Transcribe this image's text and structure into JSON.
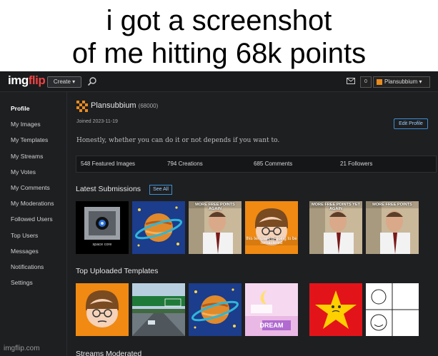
{
  "caption": {
    "line1": "i got a screenshot",
    "line2": "of me hitting 68k points"
  },
  "topbar": {
    "logo_main": "img",
    "logo_accent": "flip",
    "create_label": "Create ▾",
    "notif_count": "0",
    "user_label": "Plansubbium ▾"
  },
  "sidebar": {
    "items": [
      {
        "label": "Profile"
      },
      {
        "label": "My Images"
      },
      {
        "label": "My Templates"
      },
      {
        "label": "My Streams"
      },
      {
        "label": "My Votes"
      },
      {
        "label": "My Comments"
      },
      {
        "label": "My Moderations"
      },
      {
        "label": "Followed Users"
      },
      {
        "label": "Top Users"
      },
      {
        "label": "Messages"
      },
      {
        "label": "Notifications"
      },
      {
        "label": "Settings"
      }
    ]
  },
  "profile": {
    "username": "Plansubbium",
    "points": "(68000)",
    "joined": "Joined 2023-11-19",
    "edit_label": "Edit Profile",
    "bio": "Honestly, whether you can do it or not depends if you want to."
  },
  "stats": {
    "featured": "548 Featured Images",
    "creations": "794 Creations",
    "comments": "685 Comments",
    "followers": "21 Followers"
  },
  "sections": {
    "latest": "Latest Submissions",
    "see_all": "See All",
    "templates": "Top Uploaded Templates",
    "streams": "Streams Moderated"
  },
  "submissions": [
    {
      "caption": "space core",
      "kind": "portal-core"
    },
    {
      "caption": "",
      "kind": "planet"
    },
    {
      "caption": "MORE FREE POINTS AGAIN",
      "kind": "man"
    },
    {
      "caption": "this template is going to be remastered",
      "kind": "face"
    },
    {
      "caption": "MORE FREE POINTS YET AGAIN",
      "kind": "man"
    },
    {
      "caption": "MORE FREE POINTS",
      "kind": "man"
    }
  ],
  "templates": [
    {
      "caption": "",
      "kind": "face"
    },
    {
      "caption": "",
      "kind": "road"
    },
    {
      "caption": "",
      "kind": "planet"
    },
    {
      "caption": "DREAM",
      "kind": "dream"
    },
    {
      "caption": "",
      "kind": "star"
    },
    {
      "caption": "",
      "kind": "comic"
    }
  ],
  "watermark": "imgflip.com"
}
